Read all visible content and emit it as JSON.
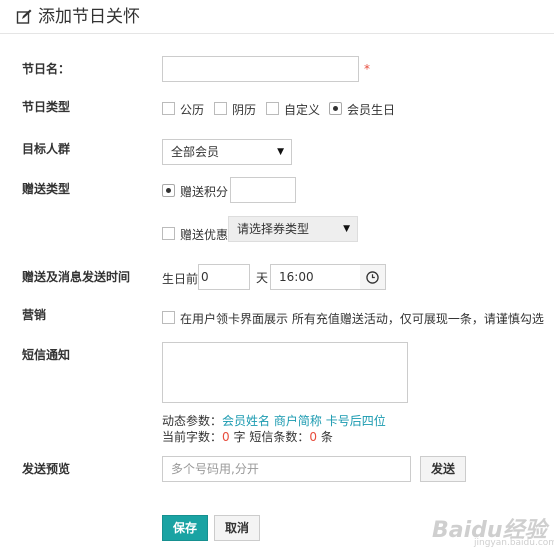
{
  "header": {
    "title": "添加节日关怀",
    "icon": "edit-icon"
  },
  "fields": {
    "festival_name": {
      "label": "节日名：",
      "value": "",
      "required_mark": "*"
    },
    "festival_type": {
      "label": "节日类型",
      "options": [
        {
          "label": "公历",
          "checked": false
        },
        {
          "label": "阴历",
          "checked": false
        },
        {
          "label": "自定义",
          "checked": false
        },
        {
          "label": "会员生日",
          "checked": true
        }
      ]
    },
    "target_group": {
      "label": "目标人群",
      "selected": "全部会员"
    },
    "gift_type": {
      "label": "赠送类型",
      "points": {
        "label": "赠送积分",
        "checked": true,
        "value": ""
      },
      "coupon": {
        "label": "赠送优惠",
        "checked": false,
        "select_placeholder": "请选择券类型"
      }
    },
    "send_time": {
      "label": "赠送及消息发送时间",
      "prefix": "生日前",
      "days": "0",
      "days_unit": "天",
      "time": "16:00"
    },
    "marketing": {
      "label": "营销",
      "text": "在用户领卡界面展示 所有充值赠送活动，仅可展现一条，请谨慎勾选"
    },
    "sms": {
      "label": "短信通知",
      "value": "",
      "params_label": "动态参数：",
      "params": [
        "会员姓名",
        "商户简称",
        "卡号后四位"
      ],
      "count_label": "当前字数：",
      "count_value": "0",
      "count_unit": "字",
      "sms_count_label": "短信条数：",
      "sms_count_value": "0",
      "sms_count_unit": "条"
    },
    "preview": {
      "label": "发送预览",
      "placeholder": "多个号码用,分开",
      "send_button": "发送"
    }
  },
  "actions": {
    "save": "保存",
    "cancel": "取消"
  },
  "watermark": {
    "text": "Baidu经验",
    "sub": "jingyan.baidu.com"
  },
  "colors": {
    "accent": "#1aa3a3",
    "link": "#1a9ab0",
    "required": "#e74c3c"
  }
}
